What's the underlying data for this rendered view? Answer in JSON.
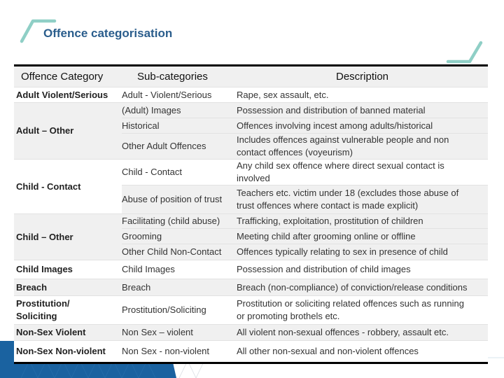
{
  "slide": {
    "title": "Offence categorisation",
    "colors": {
      "title": "#2a5d8c",
      "accent": "#8fcfc6",
      "band": "#1a62a0",
      "row_gray": "#f0f0f0",
      "row_white": "#ffffff"
    }
  },
  "table": {
    "headers": {
      "category": "Offence Category",
      "subcategories": "Sub-categories",
      "description": "Description"
    },
    "groups": [
      {
        "category": "Adult Violent/Serious",
        "rows": [
          {
            "sub": "Adult - Violent/Serious",
            "desc": [
              "Rape, sex assault, etc."
            ]
          }
        ]
      },
      {
        "category": "Adult – Other",
        "rows": [
          {
            "sub": "(Adult) Images",
            "desc": [
              "Possession and distribution of banned material"
            ]
          },
          {
            "sub": "Historical",
            "desc": [
              "Offences involving incest among adults/historical"
            ]
          },
          {
            "sub": "Other Adult Offences",
            "desc": [
              "Includes offences against vulnerable people and non",
              "contact offences (voyeurism)"
            ]
          }
        ]
      },
      {
        "category": "Child - Contact",
        "rows": [
          {
            "sub": "Child - Contact",
            "desc": [
              "Any child sex offence where direct sexual contact is",
              "involved"
            ]
          },
          {
            "sub": "Abuse of position of trust",
            "desc": [
              "Teachers etc. victim under 18 (excludes those abuse of",
              "trust offences where contact is made explicit)"
            ]
          }
        ]
      },
      {
        "category": "Child – Other",
        "rows": [
          {
            "sub": "Facilitating (child abuse)",
            "desc": [
              "Trafficking, exploitation, prostitution of children"
            ]
          },
          {
            "sub": "Grooming",
            "desc": [
              "Meeting child after grooming online or offline"
            ]
          },
          {
            "sub": "Other Child Non-Contact",
            "desc": [
              "Offences typically relating to sex in presence of child"
            ]
          }
        ]
      },
      {
        "category": "Child Images",
        "rows": [
          {
            "sub": "Child Images",
            "desc": [
              "Possession and distribution of child images"
            ]
          }
        ]
      },
      {
        "category": "Breach",
        "rows": [
          {
            "sub": "Breach",
            "desc": [
              "Breach (non-compliance) of conviction/release conditions"
            ]
          }
        ]
      },
      {
        "category": "Prostitution/ Soliciting",
        "category_lines": [
          "Prostitution/",
          "Soliciting"
        ],
        "rows": [
          {
            "sub": "Prostitution/Soliciting",
            "desc": [
              "Prostitution or soliciting related offences such as running",
              "or promoting brothels etc."
            ]
          }
        ]
      },
      {
        "category": "Non-Sex Violent",
        "rows": [
          {
            "sub": "Non Sex – violent",
            "desc": [
              "All violent non-sexual offences - robbery, assault etc."
            ]
          }
        ]
      },
      {
        "category": "Non-Sex Non-violent",
        "rows": [
          {
            "sub": "Non Sex - non-violent",
            "desc": [
              "All other non-sexual and non-violent offences"
            ]
          }
        ]
      }
    ]
  }
}
